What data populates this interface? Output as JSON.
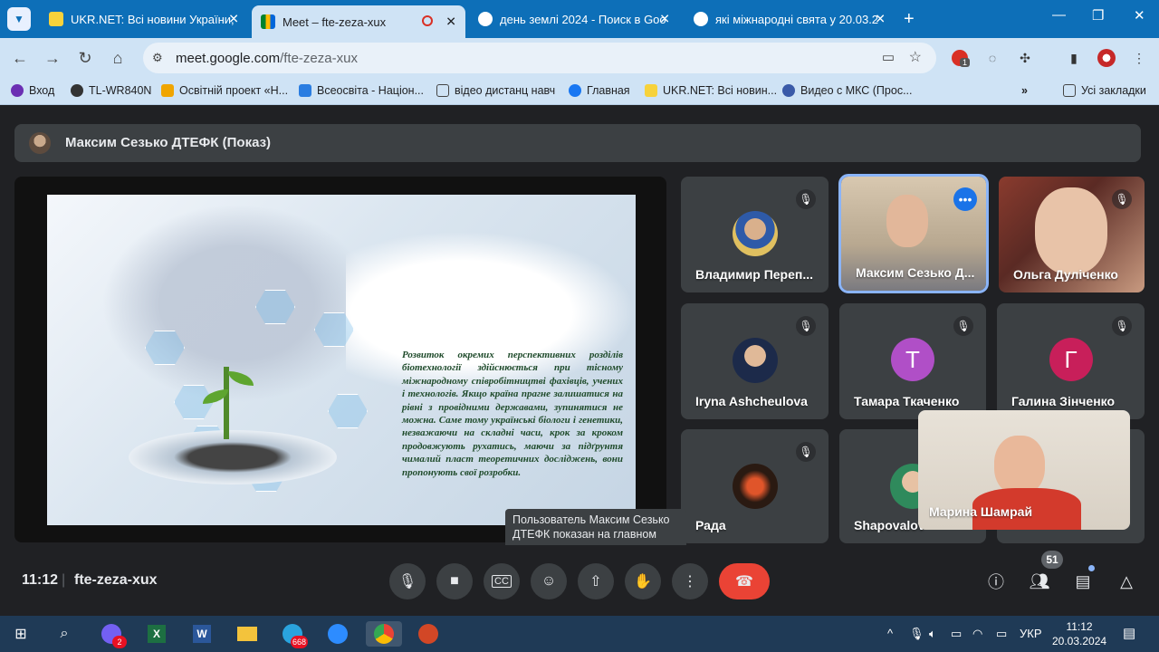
{
  "browser": {
    "tabs": [
      {
        "title": "UKR.NET: Всі новини України, "
      },
      {
        "title": "Meet – fte-zeza-xux",
        "active": true
      },
      {
        "title": "день землі 2024 - Поиск в Goo"
      },
      {
        "title": "які міжнародні свята у 20.03.2"
      }
    ],
    "url_host": "meet.google.com",
    "url_path": "/fte-zeza-xux",
    "ext_badge": "1",
    "bookmarks": [
      {
        "label": "Вход"
      },
      {
        "label": "TL-WR840N"
      },
      {
        "label": "Освітній проект «Н..."
      },
      {
        "label": "Всеосвіта - Націон..."
      },
      {
        "label": "відео дистанц навч"
      },
      {
        "label": "Главная"
      },
      {
        "label": "UKR.NET: Всі новин..."
      },
      {
        "label": "Видео с МКС (Прос..."
      }
    ],
    "all_bookmarks": "Усі закладки",
    "more_bookmarks": "»"
  },
  "meet": {
    "presenter": "Максим Сезько ДТЕФК (Показ)",
    "slide_text": "Розвиток окремих перспективних розділів біотехнології здійснюється при тісному міжнародному співробітництві фахівців, учених і технологів. Якщо країна прагне залишатися на рівні з провідними державами, зупинятися не можна. Саме тому українські біологи і генетики, незважаючи на складні часи, крок за кроком продовжують рухатись, маючи за підґрунтя чималий пласт теоретичних досліджень, вони пропонують свої розробки.",
    "participants": [
      {
        "name": "Владимир Переп..."
      },
      {
        "name": "Максим Сезько Д..."
      },
      {
        "name": "Ольга Дуліченко"
      },
      {
        "name": "Iryna Ashcheulova"
      },
      {
        "name": "Тамара Ткаченко",
        "initial": "Т"
      },
      {
        "name": "Галина Зінченко",
        "initial": "Г"
      },
      {
        "name": "Рада"
      },
      {
        "name": "Shapovalov"
      },
      {
        "name": "Марина Шамрай"
      }
    ],
    "tooltip": "Пользователь Максим Сезько ДТЕФК показан на главном экране",
    "time": "11:12",
    "separator": "|",
    "meeting_code": "fte-zeza-xux",
    "people_count": "51"
  },
  "taskbar": {
    "viber_badge": "2",
    "telegram_badge": "668",
    "lang": "УКР",
    "time": "11:12",
    "date": "20.03.2024"
  },
  "colors": {
    "chrome_blue": "#0d6fb8",
    "meet_bg": "#202124",
    "tile_bg": "#3c4043",
    "end_call": "#ea4335",
    "avatar_purple": "#b04fc7",
    "avatar_pink": "#c81f5a"
  }
}
